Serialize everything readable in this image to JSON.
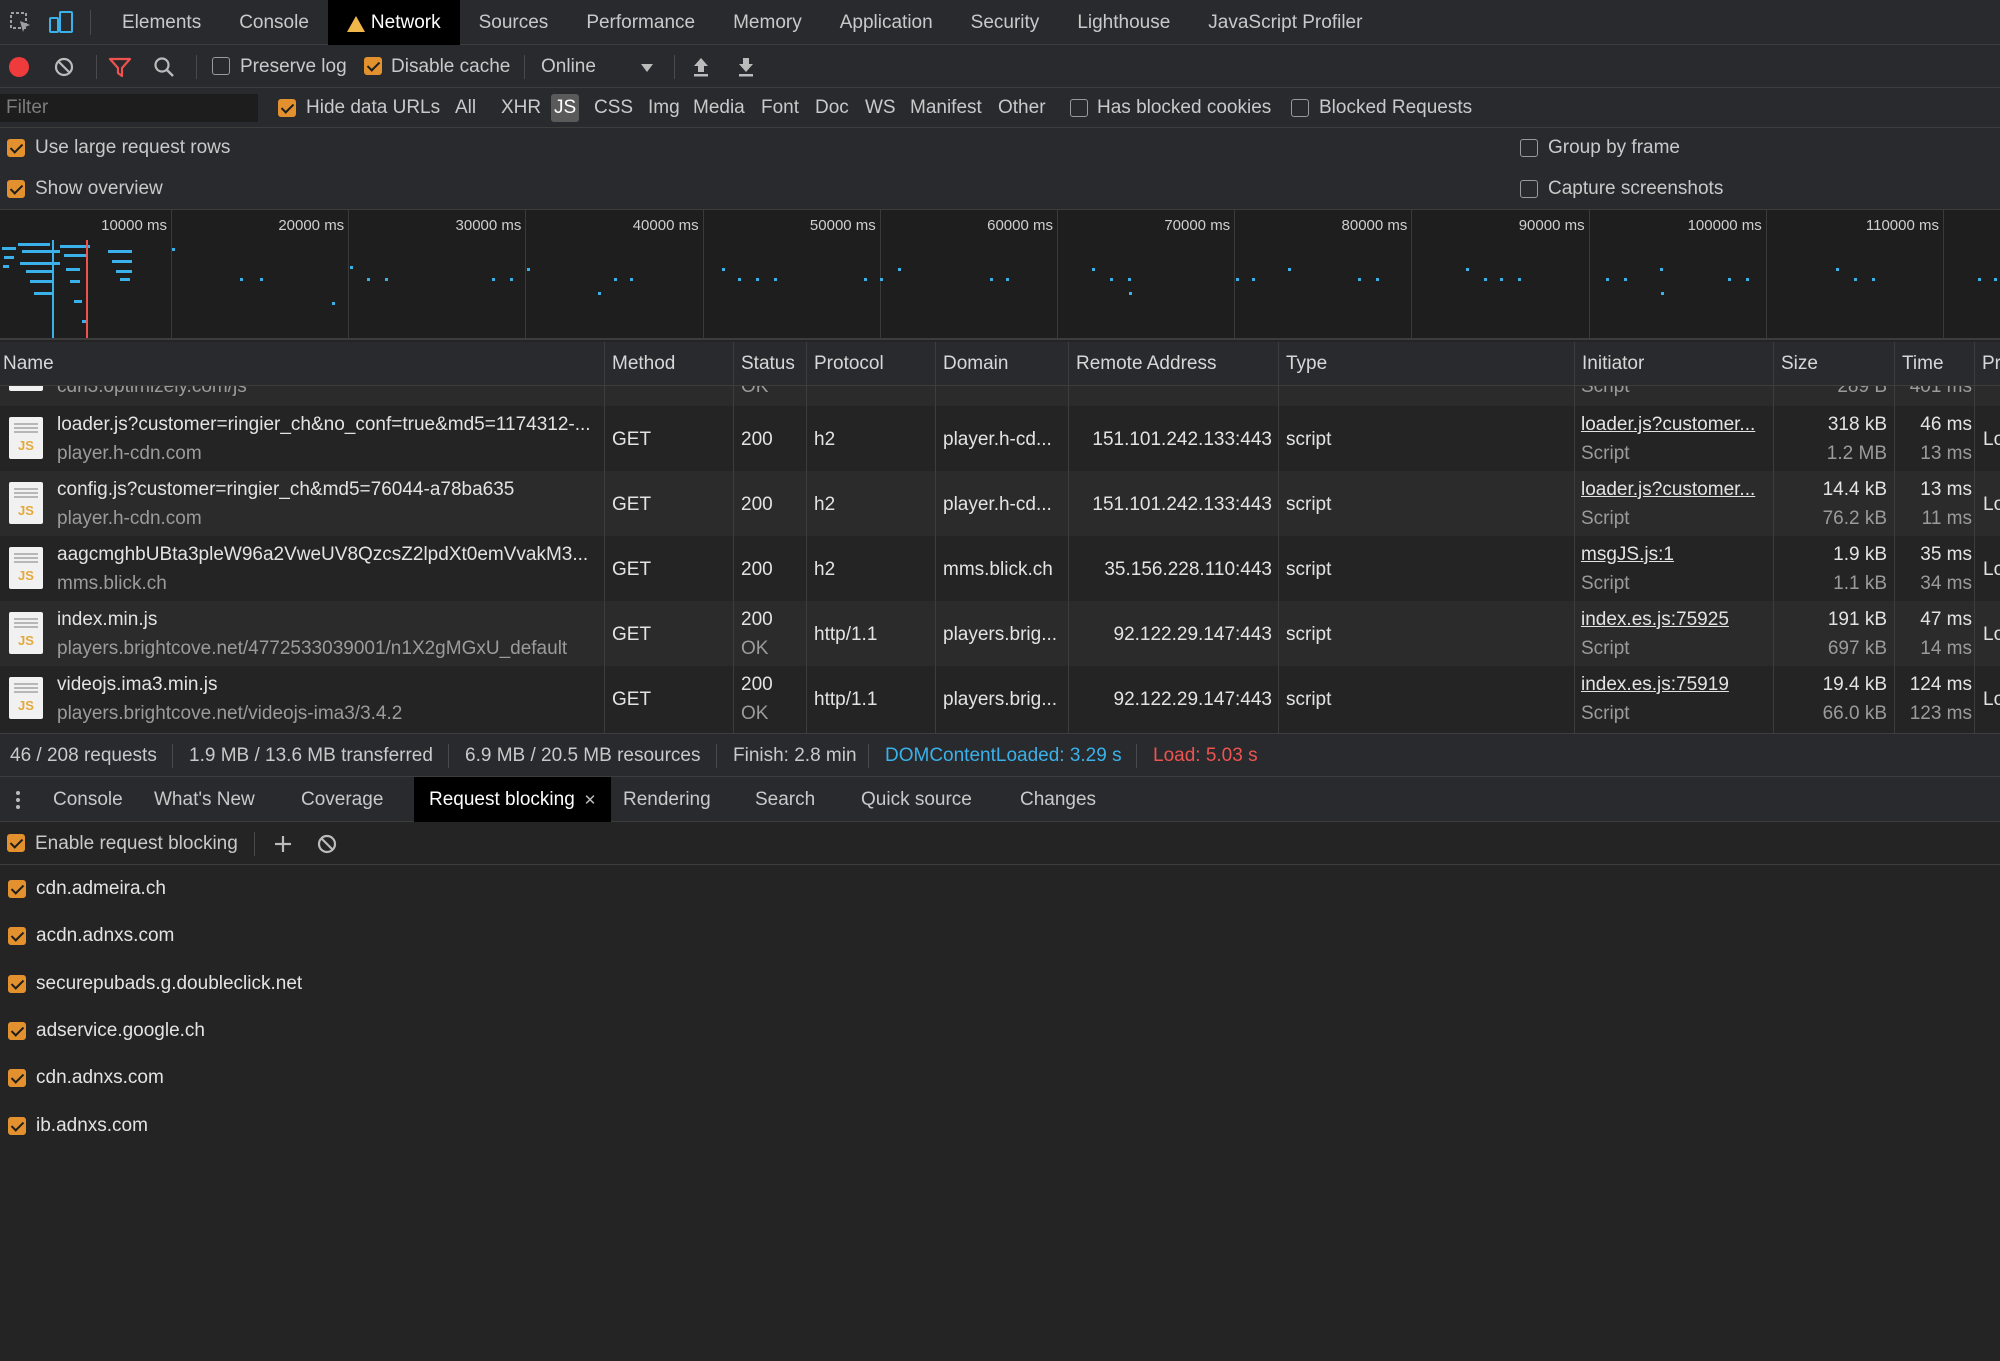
{
  "main_tabs": [
    {
      "label": "Elements",
      "active": false
    },
    {
      "label": "Console",
      "active": false
    },
    {
      "label": "Network",
      "active": true,
      "warning": true
    },
    {
      "label": "Sources",
      "active": false
    },
    {
      "label": "Performance",
      "active": false
    },
    {
      "label": "Memory",
      "active": false
    },
    {
      "label": "Application",
      "active": false
    },
    {
      "label": "Security",
      "active": false
    },
    {
      "label": "Lighthouse",
      "active": false
    },
    {
      "label": "JavaScript Profiler",
      "active": false
    }
  ],
  "toolbar": {
    "preserve_log": {
      "label": "Preserve log",
      "checked": false
    },
    "disable_cache": {
      "label": "Disable cache",
      "checked": true
    },
    "throttle": "Online"
  },
  "filter": {
    "placeholder": "Filter",
    "hide_data_urls": {
      "label": "Hide data URLs",
      "checked": true
    },
    "types": [
      {
        "label": "All",
        "active": false
      },
      {
        "label": "XHR",
        "active": false
      },
      {
        "label": "JS",
        "active": true
      },
      {
        "label": "CSS",
        "active": false
      },
      {
        "label": "Img",
        "active": false
      },
      {
        "label": "Media",
        "active": false
      },
      {
        "label": "Font",
        "active": false
      },
      {
        "label": "Doc",
        "active": false
      },
      {
        "label": "WS",
        "active": false
      },
      {
        "label": "Manifest",
        "active": false
      },
      {
        "label": "Other",
        "active": false
      }
    ],
    "has_blocked_cookies": {
      "label": "Has blocked cookies",
      "checked": false
    },
    "blocked_requests": {
      "label": "Blocked Requests",
      "checked": false
    }
  },
  "options": {
    "large_rows": {
      "label": "Use large request rows",
      "checked": true
    },
    "show_overview": {
      "label": "Show overview",
      "checked": true
    },
    "group_by_frame": {
      "label": "Group by frame",
      "checked": false
    },
    "capture_screenshots": {
      "label": "Capture screenshots",
      "checked": false
    }
  },
  "overview": {
    "ticks": [
      "10000 ms",
      "20000 ms",
      "30000 ms",
      "40000 ms",
      "50000 ms",
      "60000 ms",
      "70000 ms",
      "80000 ms",
      "90000 ms",
      "100000 ms",
      "110000 ms"
    ]
  },
  "columns": [
    "Name",
    "Method",
    "Status",
    "Protocol",
    "Domain",
    "Remote Address",
    "Type",
    "Initiator",
    "Size",
    "Time",
    "Pr"
  ],
  "partial_row": {
    "name_sub": "cdn3.optimizely.com/js",
    "status_sub": "OK",
    "initiator_sub": "Script",
    "size_sub": "289 B",
    "time_sub": "401 ms"
  },
  "requests": [
    {
      "name": "loader.js?customer=ringier_ch&no_conf=true&md5=1174312-...",
      "url": "player.h-cdn.com",
      "method": "GET",
      "status": "200",
      "status_text": "",
      "protocol": "h2",
      "domain": "player.h-cd...",
      "remote": "151.101.242.133:443",
      "type": "script",
      "initiator": "loader.js?customer...",
      "initiator_type": "Script",
      "size": "318 kB",
      "resource": "1.2 MB",
      "time": "46 ms",
      "latency": "13 ms",
      "priority": "Lo"
    },
    {
      "name": "config.js?customer=ringier_ch&md5=76044-a78ba635",
      "url": "player.h-cdn.com",
      "method": "GET",
      "status": "200",
      "status_text": "",
      "protocol": "h2",
      "domain": "player.h-cd...",
      "remote": "151.101.242.133:443",
      "type": "script",
      "initiator": "loader.js?customer...",
      "initiator_type": "Script",
      "size": "14.4 kB",
      "resource": "76.2 kB",
      "time": "13 ms",
      "latency": "11 ms",
      "priority": "Lo"
    },
    {
      "name": "aagcmghbUBta3pleW96a2VweUV8QzcsZ2lpdXt0emVvakM3...",
      "url": "mms.blick.ch",
      "method": "GET",
      "status": "200",
      "status_text": "",
      "protocol": "h2",
      "domain": "mms.blick.ch",
      "remote": "35.156.228.110:443",
      "type": "script",
      "initiator": "msgJS.js:1",
      "initiator_type": "Script",
      "size": "1.9 kB",
      "resource": "1.1 kB",
      "time": "35 ms",
      "latency": "34 ms",
      "priority": "Lo"
    },
    {
      "name": "index.min.js",
      "url": "players.brightcove.net/4772533039001/n1X2gMGxU_default",
      "method": "GET",
      "status": "200",
      "status_text": "OK",
      "protocol": "http/1.1",
      "domain": "players.brig...",
      "remote": "92.122.29.147:443",
      "type": "script",
      "initiator": "index.es.js:75925",
      "initiator_type": "Script",
      "size": "191 kB",
      "resource": "697 kB",
      "time": "47 ms",
      "latency": "14 ms",
      "priority": "Lo"
    },
    {
      "name": "videojs.ima3.min.js",
      "url": "players.brightcove.net/videojs-ima3/3.4.2",
      "method": "GET",
      "status": "200",
      "status_text": "OK",
      "protocol": "http/1.1",
      "domain": "players.brig...",
      "remote": "92.122.29.147:443",
      "type": "script",
      "initiator": "index.es.js:75919",
      "initiator_type": "Script",
      "size": "19.4 kB",
      "resource": "66.0 kB",
      "time": "124 ms",
      "latency": "123 ms",
      "priority": "Lo"
    }
  ],
  "summary": {
    "requests": "46 / 208 requests",
    "transferred": "1.9 MB / 13.6 MB transferred",
    "resources": "6.9 MB / 20.5 MB resources",
    "finish": "Finish: 2.8 min",
    "dcl": "DOMContentLoaded: 3.29 s",
    "load": "Load: 5.03 s",
    "dcl_color": "#3ab1ea",
    "load_color": "#ef5350"
  },
  "drawer_tabs": [
    {
      "label": "Console",
      "active": false
    },
    {
      "label": "What's New",
      "active": false
    },
    {
      "label": "Coverage",
      "active": false
    },
    {
      "label": "Request blocking",
      "active": true,
      "closable": true
    },
    {
      "label": "Rendering",
      "active": false
    },
    {
      "label": "Search",
      "active": false
    },
    {
      "label": "Quick source",
      "active": false
    },
    {
      "label": "Changes",
      "active": false
    }
  ],
  "request_blocking": {
    "enable": {
      "label": "Enable request blocking",
      "checked": true
    },
    "patterns": [
      {
        "pattern": "cdn.admeira.ch",
        "enabled": true
      },
      {
        "pattern": "acdn.adnxs.com",
        "enabled": true
      },
      {
        "pattern": "securepubads.g.doubleclick.net",
        "enabled": true
      },
      {
        "pattern": "adservice.google.ch",
        "enabled": true
      },
      {
        "pattern": "cdn.adnxs.com",
        "enabled": true
      },
      {
        "pattern": "ib.adnxs.com",
        "enabled": true
      }
    ]
  },
  "colors": {
    "accent": "#e2912e",
    "record": "#ef3b3b",
    "filter_icon": "#ef5350",
    "overview_bars": "#3ab1ea"
  }
}
